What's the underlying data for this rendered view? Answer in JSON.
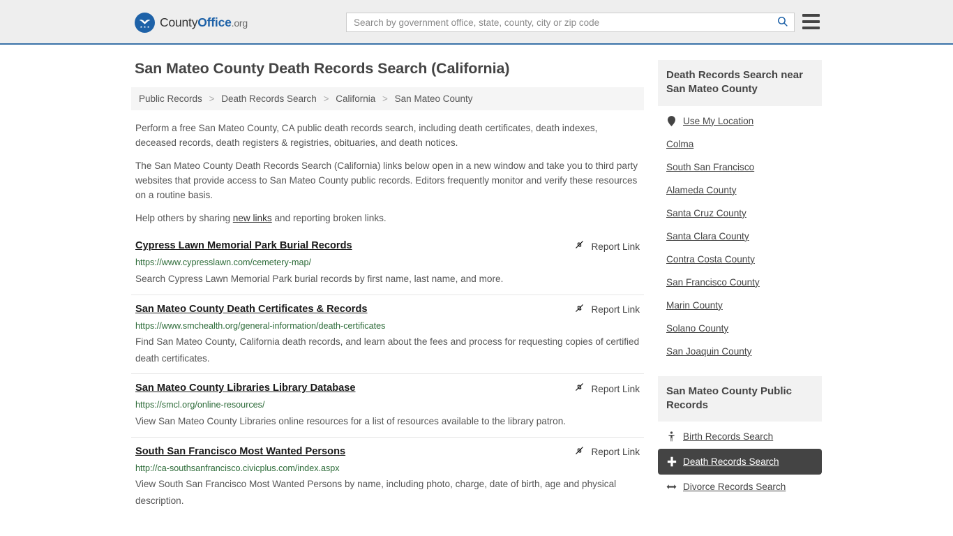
{
  "header": {
    "logo": {
      "prefix": "County",
      "bold": "Office",
      "suffix": ".org",
      "icon": "eagle-seal-icon"
    },
    "search": {
      "placeholder": "Search by government office, state, county, city or zip code",
      "value": "",
      "icon": "search-icon"
    },
    "menu_icon": "hamburger-menu-icon"
  },
  "page": {
    "title": "San Mateo County Death Records Search (California)"
  },
  "breadcrumb": {
    "separator": ">",
    "items": [
      "Public Records",
      "Death Records Search",
      "California",
      "San Mateo County"
    ]
  },
  "intro": {
    "p1": "Perform a free San Mateo County, CA public death records search, including death certificates, death indexes, deceased records, death registers & registries, obituaries, and death notices.",
    "p2": "The San Mateo County Death Records Search (California) links below open in a new window and take you to third party websites that provide access to San Mateo County public records. Editors frequently monitor and verify these resources on a routine basis.",
    "p3_before": "Help others by sharing ",
    "p3_link": "new links",
    "p3_after": " and reporting broken links."
  },
  "results": {
    "report_label": "Report Link",
    "report_icon": "broken-link-icon",
    "items": [
      {
        "title": "Cypress Lawn Memorial Park Burial Records",
        "url": "https://www.cypresslawn.com/cemetery-map/",
        "description": "Search Cypress Lawn Memorial Park burial records by first name, last name, and more."
      },
      {
        "title": "San Mateo County Death Certificates & Records",
        "url": "https://www.smchealth.org/general-information/death-certificates",
        "description": "Find San Mateo County, California death records, and learn about the fees and process for requesting copies of certified death certificates."
      },
      {
        "title": "San Mateo County Libraries Library Database",
        "url": "https://smcl.org/online-resources/",
        "description": "View San Mateo County Libraries online resources for a list of resources available to the library patron."
      },
      {
        "title": "South San Francisco Most Wanted Persons",
        "url": "http://ca-southsanfrancisco.civicplus.com/index.aspx",
        "description": "View South San Francisco Most Wanted Persons by name, including photo, charge, date of birth, age and physical description."
      }
    ]
  },
  "sidebar": {
    "nearby": {
      "heading": "Death Records Search near San Mateo County",
      "items": [
        {
          "label": "Use My Location",
          "icon": "map-pin-icon"
        },
        {
          "label": "Colma",
          "icon": ""
        },
        {
          "label": "South San Francisco",
          "icon": ""
        },
        {
          "label": "Alameda County",
          "icon": ""
        },
        {
          "label": "Santa Cruz County",
          "icon": ""
        },
        {
          "label": "Santa Clara County",
          "icon": ""
        },
        {
          "label": "Contra Costa County",
          "icon": ""
        },
        {
          "label": "San Francisco County",
          "icon": ""
        },
        {
          "label": "Marin County",
          "icon": ""
        },
        {
          "label": "Solano County",
          "icon": ""
        },
        {
          "label": "San Joaquin County",
          "icon": ""
        }
      ]
    },
    "public_records": {
      "heading": "San Mateo County Public Records",
      "items": [
        {
          "label": "Birth Records Search",
          "icon": "baby-icon",
          "active": false
        },
        {
          "label": "Death Records Search",
          "icon": "cross-icon",
          "active": true
        },
        {
          "label": "Divorce Records Search",
          "icon": "split-arrows-icon",
          "active": false
        }
      ]
    }
  },
  "colors": {
    "brand_blue": "#1e62a8",
    "header_bg": "#eeeeee",
    "url_green": "#2c6b38",
    "active_bg": "#444444"
  }
}
